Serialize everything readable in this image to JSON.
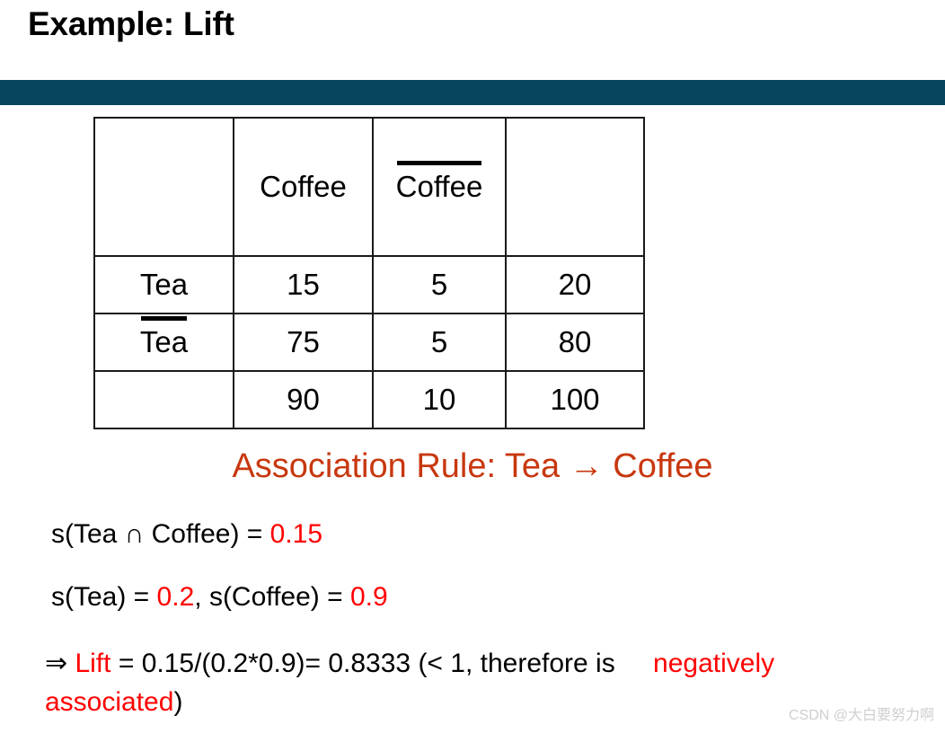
{
  "slide": {
    "title": "Example: Lift",
    "accent_bar_color": "#064460",
    "rule_color": "#C8380F",
    "highlight_color": "#FF0000"
  },
  "table": {
    "header": [
      "",
      "Coffee",
      "Coffee",
      ""
    ],
    "header_overline_flags": [
      false,
      false,
      true,
      false
    ],
    "rows": [
      {
        "label": "Tea",
        "label_overline": false,
        "cells": [
          "15",
          "5",
          "20"
        ]
      },
      {
        "label": "Tea",
        "label_overline": true,
        "cells": [
          "75",
          "5",
          "80"
        ]
      },
      {
        "label": "",
        "label_overline": false,
        "cells": [
          "90",
          "10",
          "100"
        ]
      }
    ]
  },
  "association_rule": {
    "prefix": "Association Rule: ",
    "antecedent": "Tea",
    "arrow": "→",
    "consequent": "Coffee",
    "full_text": "Association Rule: Tea → Coffee"
  },
  "formulas": {
    "support_both": {
      "label": "s(Tea ∩ Coffee) = ",
      "value": "0.15"
    },
    "supports": {
      "label_a": "s(Tea) = ",
      "value_a": "0.2",
      "separator": ", ",
      "label_b": "s(Coffee) = ",
      "value_b": "0.9"
    },
    "lift": {
      "implies": "⇒ ",
      "name": "Lift",
      "expression": " = 0.15/(0.2*0.9)= 0.8333 (< 1, therefore is ",
      "conclusion": "negatively associated",
      "closing": ")"
    }
  },
  "watermark": {
    "text": "CSDN @大白要努力啊"
  }
}
